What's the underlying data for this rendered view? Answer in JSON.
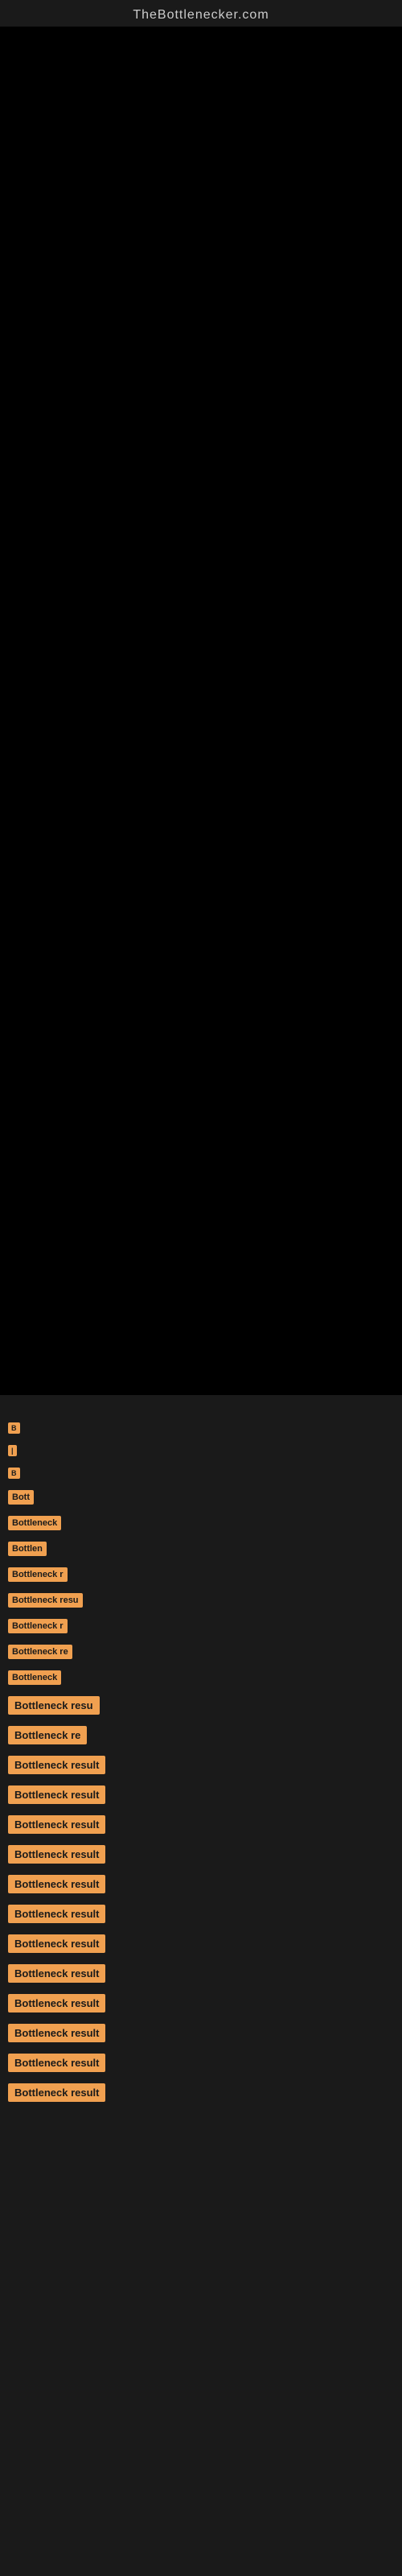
{
  "site": {
    "title": "TheBottlenecker.com"
  },
  "results": [
    {
      "id": 1,
      "label": "B",
      "size": "tiny"
    },
    {
      "id": 2,
      "label": "|",
      "size": "tiny"
    },
    {
      "id": 3,
      "label": "B",
      "size": "tiny"
    },
    {
      "id": 4,
      "label": "Bott",
      "size": "small"
    },
    {
      "id": 5,
      "label": "Bottleneck",
      "size": "small"
    },
    {
      "id": 6,
      "label": "Bottlen",
      "size": "small"
    },
    {
      "id": 7,
      "label": "Bottleneck r",
      "size": "small"
    },
    {
      "id": 8,
      "label": "Bottleneck resu",
      "size": "small"
    },
    {
      "id": 9,
      "label": "Bottleneck r",
      "size": "small"
    },
    {
      "id": 10,
      "label": "Bottleneck re",
      "size": "small"
    },
    {
      "id": 11,
      "label": "Bottleneck",
      "size": "small"
    },
    {
      "id": 12,
      "label": "Bottleneck resu",
      "size": "normal"
    },
    {
      "id": 13,
      "label": "Bottleneck re",
      "size": "normal"
    },
    {
      "id": 14,
      "label": "Bottleneck result",
      "size": "normal"
    },
    {
      "id": 15,
      "label": "Bottleneck result",
      "size": "normal"
    },
    {
      "id": 16,
      "label": "Bottleneck result",
      "size": "normal"
    },
    {
      "id": 17,
      "label": "Bottleneck result",
      "size": "normal"
    },
    {
      "id": 18,
      "label": "Bottleneck result",
      "size": "normal"
    },
    {
      "id": 19,
      "label": "Bottleneck result",
      "size": "normal"
    },
    {
      "id": 20,
      "label": "Bottleneck result",
      "size": "normal"
    },
    {
      "id": 21,
      "label": "Bottleneck result",
      "size": "normal"
    },
    {
      "id": 22,
      "label": "Bottleneck result",
      "size": "normal"
    },
    {
      "id": 23,
      "label": "Bottleneck result",
      "size": "normal"
    },
    {
      "id": 24,
      "label": "Bottleneck result",
      "size": "normal"
    },
    {
      "id": 25,
      "label": "Bottleneck result",
      "size": "normal"
    }
  ]
}
